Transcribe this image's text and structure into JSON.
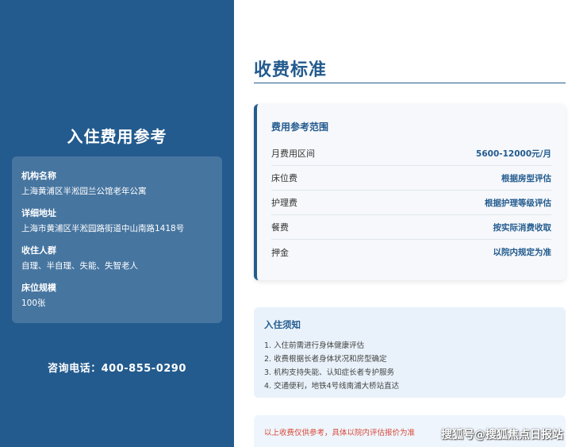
{
  "sidebar": {
    "title": "入住费用参考",
    "info": [
      {
        "label": "机构名称",
        "value": "上海黄浦区半淞园兰公馆老年公寓"
      },
      {
        "label": "详细地址",
        "value": "上海市黄浦区半淞园路街道中山南路1418号"
      },
      {
        "label": "收住人群",
        "value": "自理、半自理、失能、失智老人"
      },
      {
        "label": "床位规模",
        "value": "100张"
      }
    ],
    "phone": "咨询电话：400-855-0290"
  },
  "main": {
    "title": "收费标准",
    "fee_card": {
      "title": "费用参考范围",
      "rows": [
        {
          "label": "月费用区间",
          "value": "5600-12000元/月"
        },
        {
          "label": "床位费",
          "value": "根据房型评估"
        },
        {
          "label": "护理费",
          "value": "根据护理等级评估"
        },
        {
          "label": "餐费",
          "value": "按实际消费收取"
        },
        {
          "label": "押金",
          "value": "以院内规定为准"
        }
      ]
    },
    "notice": {
      "title": "入住须知",
      "items": [
        "1. 入住前需进行身体健康评估",
        "2. 收费根据长者身体状况和房型确定",
        "3. 机构支持失能、认知症长者专护服务",
        "4. 交通便利，地铁4号线南浦大桥站直达"
      ]
    },
    "disclaimer": "以上收费仅供参考，具体以院内评估报价为准"
  },
  "watermark": "搜狐号@搜狐焦点日报站",
  "colors": {
    "primary": "#235b8e",
    "warning": "#d94a3a"
  }
}
